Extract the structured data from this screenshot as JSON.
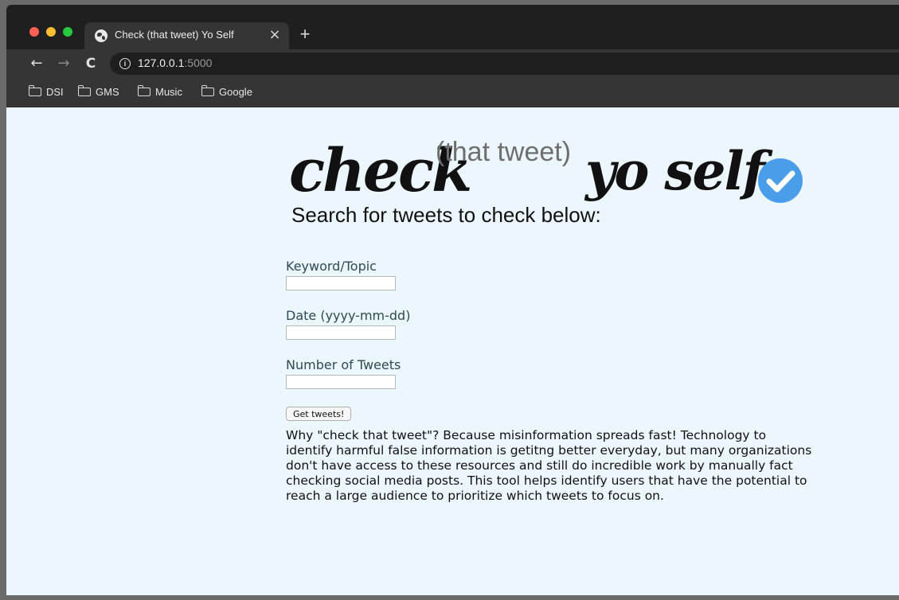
{
  "browser": {
    "tab": {
      "title": "Check (that tweet) Yo Self",
      "close_glyph": "×"
    },
    "new_tab_glyph": "+",
    "nav": {
      "back_glyph": "←",
      "forward_glyph": "→",
      "reload_glyph": "C"
    },
    "url": {
      "host": "127.0.0.1",
      "port": ":5000"
    },
    "bookmarks": [
      {
        "label": "DSI",
        "icon": "folder-icon"
      },
      {
        "label": "GMS",
        "icon": "folder-icon"
      },
      {
        "label": "Music",
        "icon": "folder-icon"
      },
      {
        "label": "Google",
        "icon": "folder-icon"
      }
    ]
  },
  "page": {
    "logo": {
      "part1": "check",
      "part2": "(that tweet)",
      "part3": "yo self",
      "icon": "verified-check-icon",
      "icon_color": "#4a9de8"
    },
    "subtitle": "Search for tweets to check below:",
    "form": {
      "keyword_label": "Keyword/Topic",
      "keyword_value": "",
      "date_label": "Date (yyyy-mm-dd)",
      "date_value": "",
      "count_label": "Number of Tweets",
      "count_value": "",
      "submit_label": "Get tweets!"
    },
    "description": "Why \"check that tweet\"? Because misinformation spreads fast! Technology to identify harmful false information is getitng better everyday, but many organizations don't have access to these resources and still do incredible work by manually fact checking social media posts. This tool helps identify users that have the potential to reach a large audience to prioritize which tweets to focus on."
  }
}
